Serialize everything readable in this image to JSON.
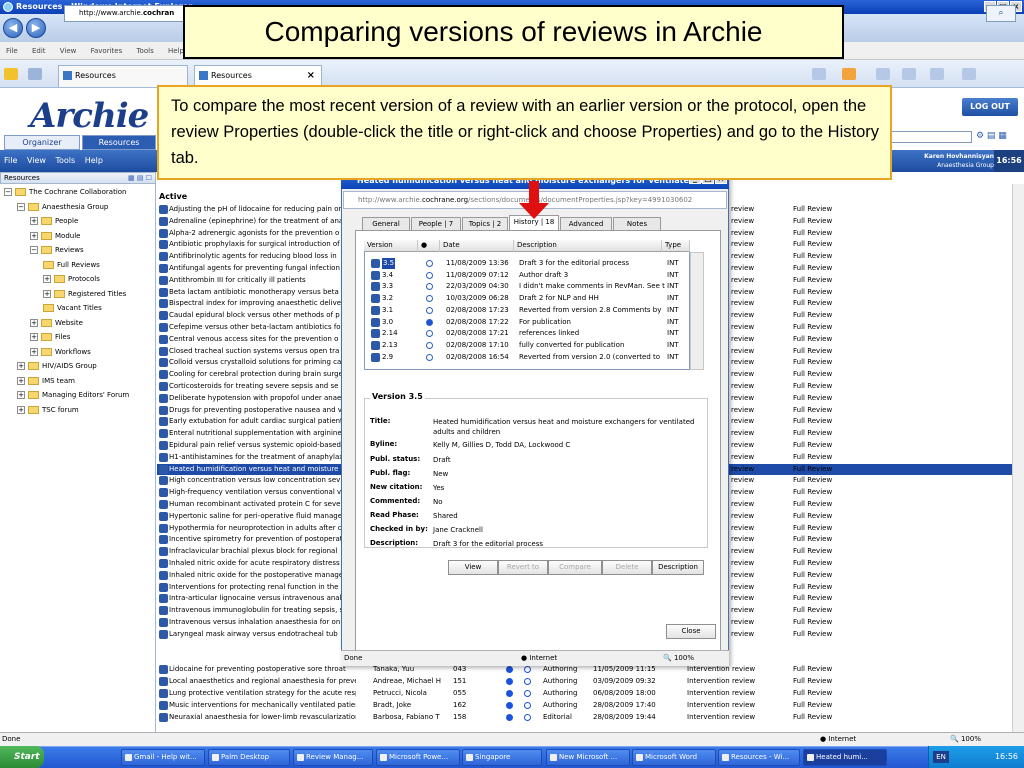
{
  "browser": {
    "window_title": "Resources - Windows Internet Explorer",
    "url_prefix": "http://www.archie.",
    "url_domain": "cochran",
    "menu": [
      "File",
      "Edit",
      "View",
      "Favorites",
      "Tools",
      "Help"
    ],
    "tabs": [
      {
        "label": "Resources"
      },
      {
        "label": "Resources"
      }
    ],
    "status_left": "Done",
    "status_zone": "Internet",
    "status_zoom": "100%"
  },
  "slide": {
    "title": "Comparing versions of reviews in Archie",
    "callout": "To compare the most recent version of a review with an earlier version or the protocol, open the review Properties (double-click the title or right-click and choose Properties) and go to the History tab."
  },
  "archie": {
    "logo": "Archie",
    "logout": "LOG OUT",
    "tabs": [
      "Organizer",
      "Resources"
    ],
    "menu": [
      "File",
      "View",
      "Tools",
      "Help"
    ],
    "user_name": "Karen Hovhannisyan",
    "user_group": "Anaesthesia Group",
    "clock": "16:56",
    "tree_header": "Resources",
    "tree": [
      {
        "label": "The Cochrane Collaboration",
        "level": 0,
        "expander": "−"
      },
      {
        "label": "Anaesthesia Group",
        "level": 1,
        "expander": "−"
      },
      {
        "label": "People",
        "level": 2,
        "expander": "+"
      },
      {
        "label": "Module",
        "level": 2,
        "expander": "+"
      },
      {
        "label": "Reviews",
        "level": 2,
        "expander": "−"
      },
      {
        "label": "Full Reviews",
        "level": 3,
        "expander": ""
      },
      {
        "label": "Protocols",
        "level": 3,
        "expander": "+"
      },
      {
        "label": "Registered Titles",
        "level": 3,
        "expander": "+"
      },
      {
        "label": "Vacant Titles",
        "level": 3,
        "expander": ""
      },
      {
        "label": "Website",
        "level": 2,
        "expander": "+"
      },
      {
        "label": "Files",
        "level": 2,
        "expander": "+"
      },
      {
        "label": "Workflows",
        "level": 2,
        "expander": "+"
      },
      {
        "label": "HIV/AIDS Group",
        "level": 1,
        "expander": "+"
      },
      {
        "label": "IMS team",
        "level": 1,
        "expander": "+"
      },
      {
        "label": "Managing Editors' Forum",
        "level": 1,
        "expander": "+"
      },
      {
        "label": "TSC forum",
        "level": 1,
        "expander": "+"
      }
    ],
    "list_section": "Active",
    "reviews": [
      "Adjusting the pH of lidocaine for reducing pain on",
      "Adrenaline (epinephrine) for the treatment of ana",
      "Alpha-2 adrenergic agonists for the prevention o",
      "Antibiotic prophylaxis for surgical introduction of",
      "Antifibrinolytic agents for reducing blood loss in",
      "Antifungal agents for preventing fungal infection",
      "Antithrombin III for critically ill patients",
      "Beta lactam antibiotic monotherapy versus beta l",
      "Bispectral index for improving anaesthetic deliver",
      "Caudal epidural block versus other methods of p",
      "Cefepime versus other beta-lactam antibiotics fo",
      "Central venous access sites for the prevention o",
      "Closed tracheal suction systems versus open tra",
      "Colloid versus crystalloid solutions for priming ca",
      "Cooling for cerebral protection during brain surge",
      "Corticosteroids for treating severe sepsis and se",
      "Deliberate hypotension with propofol under anae",
      "Drugs for preventing postoperative nausea and v",
      "Early extubation for adult cardiac surgical patient",
      "Enteral nutritional supplementation with arginine f",
      "Epidural pain relief versus systemic opioid-based",
      "H1-antihistamines for the treatment of anaphylax",
      "Heated humidification versus heat and moisture e",
      "High concentration versus low concentration sev",
      "High-frequency ventilation versus conventional v",
      "Human recombinant activated protein C for sever",
      "Hypertonic saline for peri-operative fluid manage",
      "Hypothermia for neuroprotection in adults after c",
      "Incentive spirometry for prevention of postoperat",
      "Infraclavicular brachial plexus block for regional",
      "Inhaled nitric oxide for acute respiratory distress",
      "Inhaled nitric oxide for the postoperative manage",
      "Interventions for protecting renal function in the p",
      "Intra-articular lignocaine versus intravenous anal",
      "Intravenous immunoglobulin for treating sepsis, s",
      "Intravenous versus inhalation anaesthesia for on",
      "Laryngeal mask airway versus endotracheal tub"
    ],
    "review_type_label": "review",
    "review_status_label": "Full Review",
    "full_rows": [
      {
        "title": "Lidocaine for preventing postoperative sore throat",
        "author": "Tanaka, Yuu",
        "num": "043",
        "phase": "Authoring",
        "date": "11/05/2009 11:15",
        "type": "Intervention review",
        "status": "Full Review"
      },
      {
        "title": "Local anaesthetics and regional anaesthesia for preventi",
        "author": "Andreae, Michael H",
        "num": "151",
        "phase": "Authoring",
        "date": "03/09/2009 09:32",
        "type": "Intervention review",
        "status": "Full Review"
      },
      {
        "title": "Lung protective ventilation strategy for the acute respirat",
        "author": "Petrucci, Nicola",
        "num": "055",
        "phase": "Authoring",
        "date": "06/08/2009 18:00",
        "type": "Intervention review",
        "status": "Full Review"
      },
      {
        "title": "Music interventions for mechanically ventilated patients",
        "author": "Bradt, Joke",
        "num": "162",
        "phase": "Authoring",
        "date": "28/08/2009 17:40",
        "type": "Intervention review",
        "status": "Full Review"
      },
      {
        "title": "Neuraxial anaesthesia for lower-limb revascularization",
        "author": "Barbosa, Fabiano T",
        "num": "158",
        "phase": "Editorial",
        "date": "28/08/2009 19:44",
        "type": "Intervention review",
        "status": "Full Review"
      }
    ]
  },
  "dialog": {
    "title": "Heated humidification versus heat and moisture exchangers for ventilated ad...",
    "url_prefix": "http://www.archie.",
    "url_domain": "cochrane.org",
    "url_suffix": "/sections/documents/documentProperties.jsp?key=4991030602",
    "tabs": [
      {
        "label": "General"
      },
      {
        "label": "People | 7"
      },
      {
        "label": "Topics | 2"
      },
      {
        "label": "History | 18"
      },
      {
        "label": "Advanced"
      },
      {
        "label": "Notes"
      }
    ],
    "columns": [
      "Version",
      "●",
      "Date",
      "Description",
      "Type"
    ],
    "versions": [
      {
        "v": "3.5",
        "date": "11/08/2009 13:36",
        "desc": "Draft 3 for the editorial process",
        "type": "INT",
        "checked": false
      },
      {
        "v": "3.4",
        "date": "11/08/2009 07:12",
        "desc": "Author draft 3",
        "type": "INT",
        "checked": false
      },
      {
        "v": "3.3",
        "date": "22/03/2009 04:30",
        "desc": "I didn't make comments in RevMan. See t",
        "type": "INT",
        "checked": false
      },
      {
        "v": "3.2",
        "date": "10/03/2009 06:28",
        "desc": "Draft 2 for NLP and HH",
        "type": "INT",
        "checked": false
      },
      {
        "v": "3.1",
        "date": "02/08/2008 17:23",
        "desc": "Reverted from version 2.8 Comments by",
        "type": "INT",
        "checked": false
      },
      {
        "v": "3.0",
        "date": "02/08/2008 17:22",
        "desc": "For publication",
        "type": "INT",
        "checked": true
      },
      {
        "v": "2.14",
        "date": "02/08/2008 17:21",
        "desc": "references linked",
        "type": "INT",
        "checked": false
      },
      {
        "v": "2.13",
        "date": "02/08/2008 17:10",
        "desc": "fully converted for publication",
        "type": "INT",
        "checked": false
      },
      {
        "v": "2.9",
        "date": "02/08/2008 16:54",
        "desc": "Reverted from version 2.0 (converted to",
        "type": "INT",
        "checked": false
      }
    ],
    "group_title": "Version 3.5",
    "fields": [
      {
        "label": "Title:",
        "value": "Heated humidification versus heat and moisture exchangers for ventilated adults and children"
      },
      {
        "label": "Byline:",
        "value": "Kelly M, Gillies D, Todd DA, Lockwood C"
      },
      {
        "label": "Publ. status:",
        "value": "Draft"
      },
      {
        "label": "Publ. flag:",
        "value": "New"
      },
      {
        "label": "New citation:",
        "value": "Yes"
      },
      {
        "label": "Commented:",
        "value": "No"
      },
      {
        "label": "Read Phase:",
        "value": "Shared"
      },
      {
        "label": "Checked in by:",
        "value": "Jane Cracknell"
      },
      {
        "label": "Description:",
        "value": "Draft 3 for the editorial process"
      }
    ],
    "buttons": {
      "view": "View",
      "revert": "Revert to",
      "compare": "Compare",
      "delete": "Delete",
      "description": "Description",
      "close": "Close"
    },
    "status_left": "Done",
    "status_zone": "Internet",
    "status_zoom": "100%"
  },
  "taskbar": {
    "start": "Start",
    "buttons": [
      "Gmail - Help wit...",
      "Palm Desktop",
      "Review Manag...",
      "Microsoft Powe...",
      "Singapore",
      "New Microsoft ...",
      "Microsoft Word",
      "Resources - Wi...",
      "Heated humi..."
    ],
    "lang": "EN",
    "clock": "16:56"
  }
}
